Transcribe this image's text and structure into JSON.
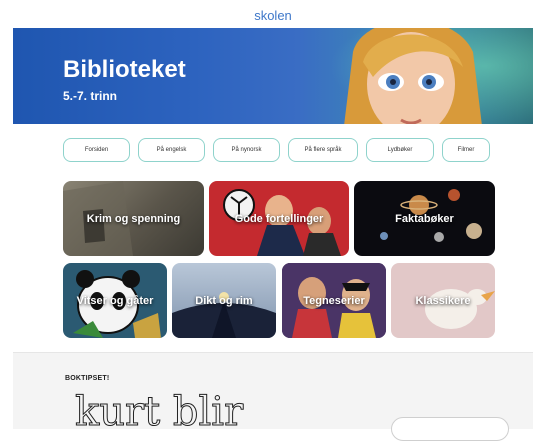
{
  "site": {
    "logo": "skolen"
  },
  "hero": {
    "title": "Biblioteket",
    "subtitle": "5.-7. trinn"
  },
  "nav": {
    "tabs": [
      "Forsiden",
      "På engelsk",
      "På nynorsk",
      "På flere språk",
      "Lydbøker",
      "Filmer"
    ]
  },
  "categories": [
    {
      "label": "Krim og spenning"
    },
    {
      "label": "Gode fortellinger"
    },
    {
      "label": "Faktabøker"
    },
    {
      "label": "Vitser og gåter"
    },
    {
      "label": "Dikt og rim"
    },
    {
      "label": "Tegneserier"
    },
    {
      "label": "Klassikere"
    }
  ],
  "boktips": {
    "heading": "BOKTIPSET!",
    "handwriting": "kurt blir"
  }
}
